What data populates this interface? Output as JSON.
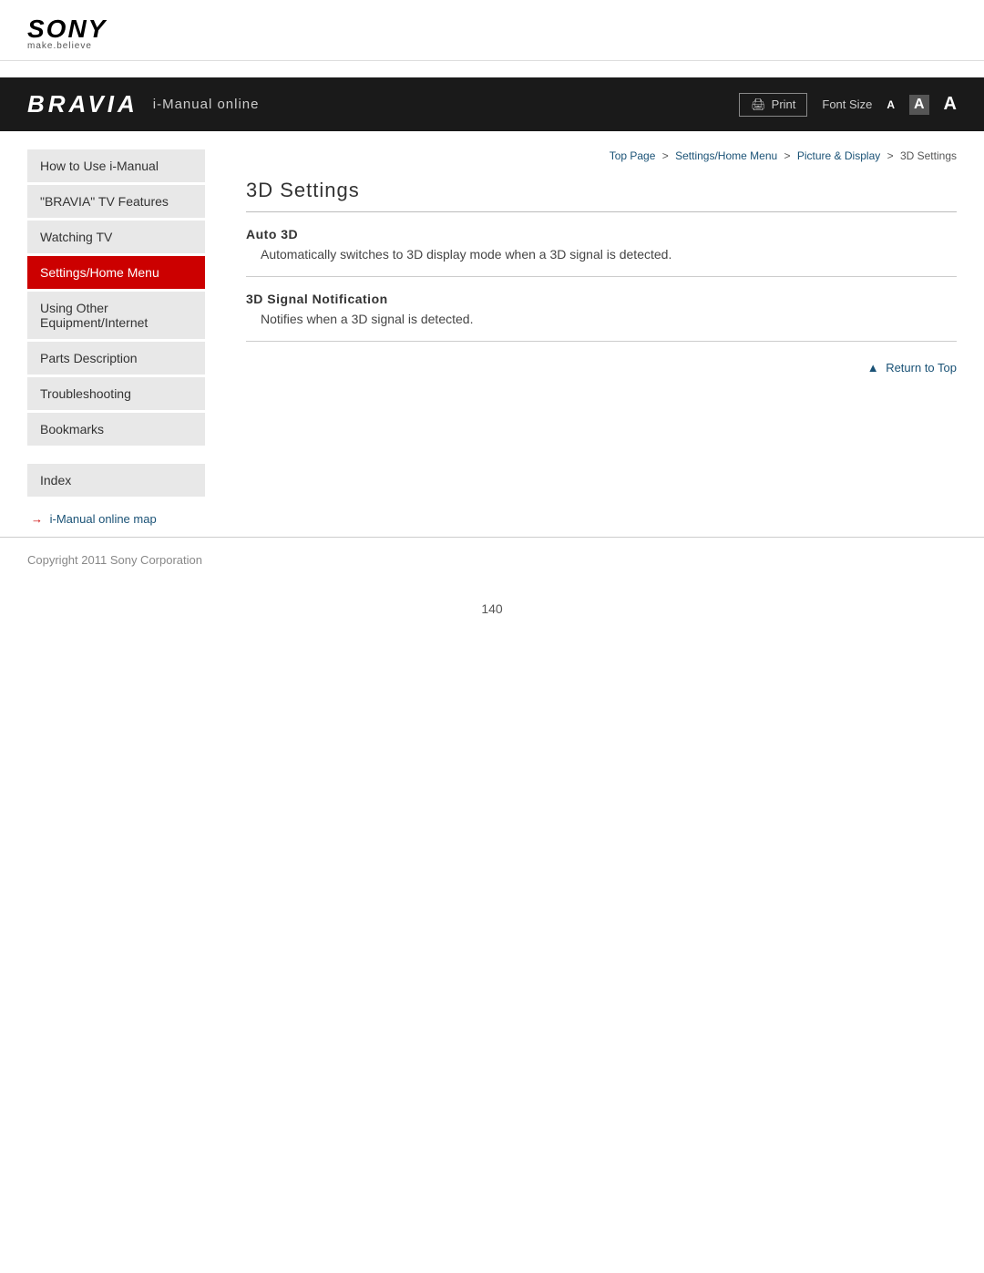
{
  "logo": {
    "brand": "SONY",
    "tagline": "make.believe"
  },
  "banner": {
    "brand": "BRAVIA",
    "subtitle": "i-Manual online",
    "print_label": "Print",
    "font_size_label": "Font Size",
    "font_small": "A",
    "font_medium": "A",
    "font_large": "A"
  },
  "breadcrumb": {
    "items": [
      "Top Page",
      "Settings/Home Menu",
      "Picture & Display",
      "3D Settings"
    ],
    "separators": [
      ">",
      ">",
      ">"
    ]
  },
  "sidebar": {
    "items": [
      {
        "id": "how-to-use",
        "label": "How to Use i-Manual",
        "active": false
      },
      {
        "id": "bravia-features",
        "label": "\"BRAVIA\" TV Features",
        "active": false
      },
      {
        "id": "watching-tv",
        "label": "Watching TV",
        "active": false
      },
      {
        "id": "settings-home",
        "label": "Settings/Home Menu",
        "active": true
      },
      {
        "id": "using-other",
        "label": "Using Other Equipment/Internet",
        "active": false
      },
      {
        "id": "parts-desc",
        "label": "Parts Description",
        "active": false
      },
      {
        "id": "troubleshooting",
        "label": "Troubleshooting",
        "active": false
      },
      {
        "id": "bookmarks",
        "label": "Bookmarks",
        "active": false
      }
    ],
    "index_label": "Index",
    "map_link_arrow": "→",
    "map_link_label": "i-Manual online map"
  },
  "content": {
    "page_title": "3D Settings",
    "sections": [
      {
        "id": "auto-3d",
        "title": "Auto 3D",
        "description": "Automatically switches to 3D display mode when a 3D signal is detected."
      },
      {
        "id": "signal-notification",
        "title": "3D Signal Notification",
        "description": "Notifies when a 3D signal is detected."
      }
    ],
    "return_to_top": "Return to Top"
  },
  "footer": {
    "copyright": "Copyright 2011 Sony Corporation"
  },
  "page_number": "140"
}
